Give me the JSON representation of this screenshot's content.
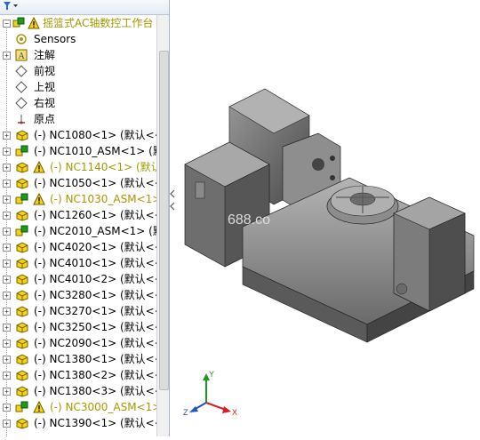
{
  "tree": {
    "root_label": "摇篮式AC轴数控工作台（",
    "items": [
      {
        "label": "Sensors",
        "icon": "sensors-icon",
        "expandable": false,
        "warn": false
      },
      {
        "label": "注解",
        "icon": "annotation-icon",
        "expandable": true,
        "warn": false
      },
      {
        "label": "前视",
        "icon": "plane-icon",
        "expandable": false,
        "warn": false
      },
      {
        "label": "上视",
        "icon": "plane-icon",
        "expandable": false,
        "warn": false
      },
      {
        "label": "右视",
        "icon": "plane-icon",
        "expandable": false,
        "warn": false
      },
      {
        "label": "原点",
        "icon": "origin-icon",
        "expandable": false,
        "warn": false
      },
      {
        "label": "(-) NC1080<1> (默认<<",
        "icon": "part-icon",
        "expandable": true,
        "warn": false
      },
      {
        "label": "(-) NC1010_ASM<1> (默",
        "icon": "assembly-icon",
        "expandable": true,
        "warn": false
      },
      {
        "label": "(-) NC1140<1> (默认<",
        "icon": "part-icon",
        "expandable": true,
        "warn": true
      },
      {
        "label": "(-) NC1050<1> (默认<<",
        "icon": "part-icon",
        "expandable": true,
        "warn": false
      },
      {
        "label": "(-) NC1030_ASM<1>",
        "icon": "assembly-icon",
        "expandable": true,
        "warn": true
      },
      {
        "label": "(-) NC1260<1> (默认<<",
        "icon": "part-icon",
        "expandable": true,
        "warn": false
      },
      {
        "label": "(-) NC2010_ASM<1> (默",
        "icon": "assembly-icon",
        "expandable": true,
        "warn": false
      },
      {
        "label": "(-) NC4020<1> (默认<<",
        "icon": "part-icon",
        "expandable": true,
        "warn": false
      },
      {
        "label": "(-) NC4010<1> (默认<<",
        "icon": "part-icon",
        "expandable": true,
        "warn": false
      },
      {
        "label": "(-) NC4010<2> (默认<<",
        "icon": "part-icon",
        "expandable": true,
        "warn": false
      },
      {
        "label": "(-) NC3280<1> (默认<<",
        "icon": "part-icon",
        "expandable": true,
        "warn": false
      },
      {
        "label": "(-) NC3270<1> (默认<<",
        "icon": "part-icon",
        "expandable": true,
        "warn": false
      },
      {
        "label": "(-) NC3250<1> (默认<<",
        "icon": "part-icon",
        "expandable": true,
        "warn": false
      },
      {
        "label": "(-) NC2090<1> (默认<<",
        "icon": "part-icon",
        "expandable": true,
        "warn": false
      },
      {
        "label": "(-) NC1380<1> (默认<<",
        "icon": "part-icon",
        "expandable": true,
        "warn": false
      },
      {
        "label": "(-) NC1380<2> (默认<<",
        "icon": "part-icon",
        "expandable": true,
        "warn": false
      },
      {
        "label": "(-) NC1380<3> (默认<<",
        "icon": "part-icon",
        "expandable": true,
        "warn": false
      },
      {
        "label": "(-) NC3000_ASM<1>",
        "icon": "assembly-icon",
        "expandable": true,
        "warn": true
      },
      {
        "label": "(-) NC1390<1> (默认<<",
        "icon": "part-icon",
        "expandable": true,
        "warn": false
      }
    ]
  },
  "viewport": {
    "watermark": "688.co",
    "axes": {
      "x": "X",
      "y": "Y",
      "z": "Z"
    }
  },
  "colors": {
    "warn_text": "#a39a00",
    "part_yellow": "#f2d21b",
    "axis_x": "#d42020",
    "axis_y": "#1b9a1b",
    "axis_z": "#2450c8"
  }
}
